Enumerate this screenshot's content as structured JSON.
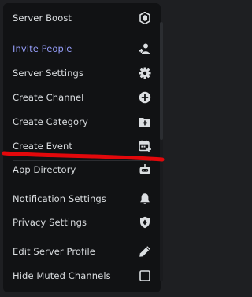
{
  "menu": {
    "items": [
      {
        "label": "Server Boost",
        "icon": "boost-gem-icon"
      },
      {
        "label": "Invite People",
        "icon": "person-add-icon"
      },
      {
        "label": "Server Settings",
        "icon": "gear-icon"
      },
      {
        "label": "Create Channel",
        "icon": "plus-circle-icon"
      },
      {
        "label": "Create Category",
        "icon": "folder-plus-icon"
      },
      {
        "label": "Create Event",
        "icon": "calendar-plus-icon"
      },
      {
        "label": "App Directory",
        "icon": "robot-icon"
      },
      {
        "label": "Notification Settings",
        "icon": "bell-icon"
      },
      {
        "label": "Privacy Settings",
        "icon": "shield-icon"
      },
      {
        "label": "Edit Server Profile",
        "icon": "pencil-icon"
      },
      {
        "label": "Hide Muted Channels",
        "icon": "checkbox-icon",
        "checked": false
      }
    ]
  },
  "colors": {
    "background": "#111214",
    "text": "#dbdee1",
    "accent": "#949cf7",
    "annotation_stroke": "#e3080b"
  }
}
